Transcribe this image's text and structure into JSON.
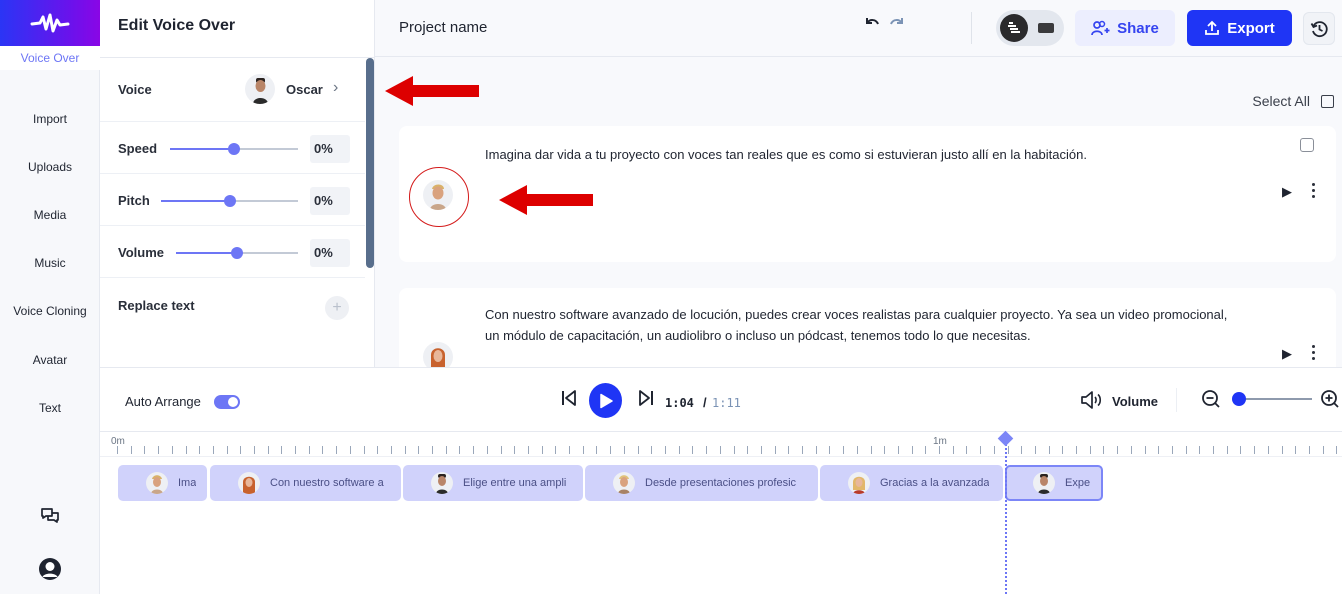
{
  "app": {
    "brand_colors": {
      "primary": "#1f35f5",
      "accent": "#6d76f5",
      "clip_bg": "#d0d2fb",
      "annotation": "#d41a1a"
    }
  },
  "rail": {
    "items": [
      {
        "label": "Voice Over",
        "active": true
      },
      {
        "label": "Import",
        "active": false
      },
      {
        "label": "Uploads",
        "active": false
      },
      {
        "label": "Media",
        "active": false
      },
      {
        "label": "Music",
        "active": false
      },
      {
        "label": "Voice Cloning",
        "active": false
      },
      {
        "label": "Avatar",
        "active": false
      },
      {
        "label": "Text",
        "active": false
      }
    ],
    "bottom_icons": [
      "chat-icon",
      "user-profile-icon"
    ]
  },
  "panel": {
    "title": "Edit Voice Over",
    "voice": {
      "label": "Voice",
      "name": "Oscar"
    },
    "speed": {
      "label": "Speed",
      "value": "0%",
      "position": 0.5
    },
    "pitch": {
      "label": "Pitch",
      "value": "0%",
      "position": 0.5
    },
    "volume": {
      "label": "Volume",
      "value": "0%",
      "position": 0.5
    },
    "replace_text": {
      "label": "Replace text"
    }
  },
  "header": {
    "project_name": "Project name",
    "share_label": "Share",
    "export_label": "Export"
  },
  "script": {
    "select_all_label": "Select All",
    "cards": [
      {
        "text": "Imagina dar vida a tu proyecto con voces tan reales que es como si estuvieran justo allí en la habitación.",
        "checked": false
      },
      {
        "text": "Con nuestro software avanzado de locución, puedes crear voces realistas para cualquier proyecto. Ya sea un video promocional, un módulo de capacitación, un audiolibro o incluso un pódcast, tenemos todo lo que necesitas.",
        "checked": false
      }
    ]
  },
  "playback": {
    "auto_arrange_label": "Auto Arrange",
    "auto_arrange_on": true,
    "current_time": "1:04",
    "separator": "/",
    "total_time": "1:11",
    "volume_label": "Volume",
    "zoom_level": 0
  },
  "timeline": {
    "ruler_labels": [
      "0m",
      "1m"
    ],
    "playhead_time": "1:04",
    "clips": [
      {
        "text": "Ima",
        "selected": false
      },
      {
        "text": "Con nuestro software a",
        "selected": false
      },
      {
        "text": "Elige entre una ampli",
        "selected": false
      },
      {
        "text": "Desde presentaciones profesic",
        "selected": false
      },
      {
        "text": "Gracias a la avanzada",
        "selected": false
      },
      {
        "text": "Expe",
        "selected": true
      }
    ]
  }
}
